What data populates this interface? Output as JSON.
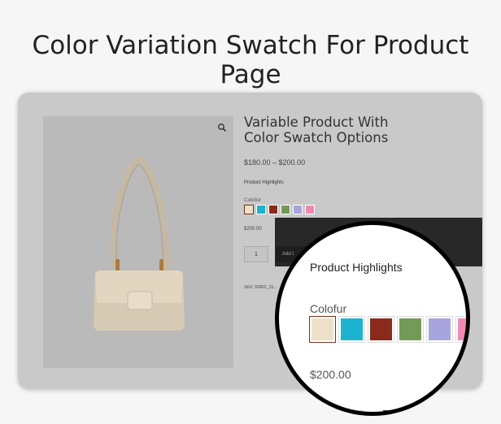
{
  "banner": {
    "title": "Color Variation Swatch For Product Page"
  },
  "product": {
    "title": "Variable Product With Color Swatch Options",
    "price_range": "$180.00 – $200.00",
    "highlights_label": "Product Highlights",
    "colour_label": "Colofur",
    "selected_price": "$200.00",
    "quantity": "1",
    "add_to_cart_label": "Add t",
    "sku_text": "SKU: SWRC_01..."
  },
  "swatches": [
    {
      "name": "cream",
      "color": "#ede0c8",
      "selected": true
    },
    {
      "name": "cyan",
      "color": "#1cb3d1",
      "selected": false
    },
    {
      "name": "maroon",
      "color": "#8a2a1c",
      "selected": false
    },
    {
      "name": "green",
      "color": "#749a58",
      "selected": false
    },
    {
      "name": "lavender",
      "color": "#a8a4de",
      "selected": false
    },
    {
      "name": "pink",
      "color": "#f08ab2",
      "selected": false
    }
  ],
  "icons": {
    "zoom": "magnifier-icon"
  }
}
